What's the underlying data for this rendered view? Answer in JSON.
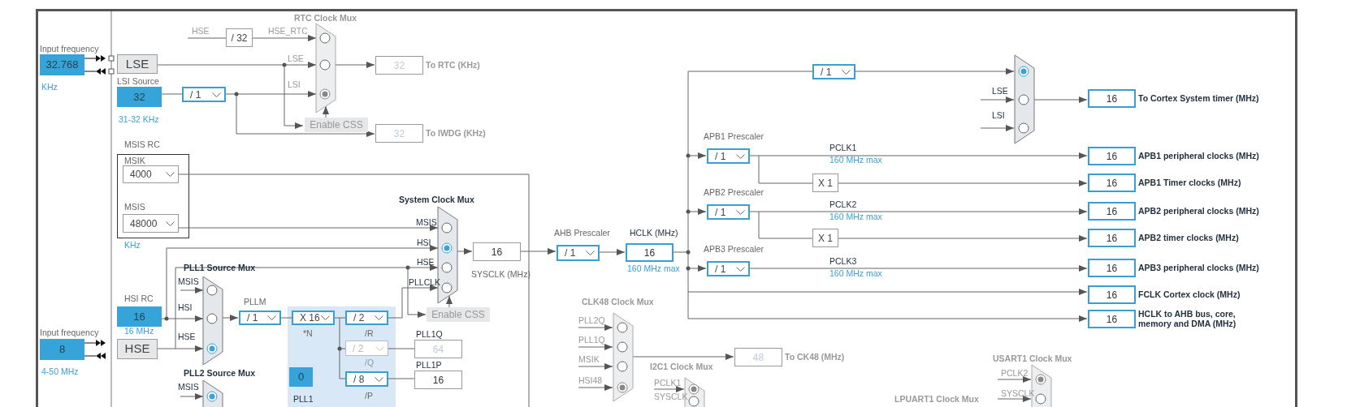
{
  "input_clocks": [
    {
      "label": "Input frequency",
      "value": "32.768",
      "range": "KHz"
    },
    {
      "label": "Input frequency",
      "value": "8",
      "range": "4-50 MHz"
    }
  ],
  "oscillators": [
    {
      "name": "LSE"
    },
    {
      "name": "HSE"
    }
  ],
  "rc_sources": [
    {
      "title": "LSI Source",
      "value": "32",
      "range": "31-32 KHz"
    },
    {
      "title": "HSI RC",
      "value": "16",
      "range": "16 MHz"
    }
  ],
  "msis_rc": {
    "title": "MSIS RC",
    "selectors": [
      {
        "label": "MSIK",
        "value": "4000"
      },
      {
        "label": "MSIS",
        "value": "48000"
      }
    ],
    "unit": "KHz"
  },
  "signal_labels": [
    {
      "text": "HSE"
    }
  ],
  "dividers": [
    {
      "value": "/ 32"
    },
    {
      "value": "X 1"
    },
    {
      "value": "X 1"
    }
  ],
  "prescalers": [
    {
      "value": "/ 1",
      "disabled": false
    },
    {
      "title": "AHB Prescaler",
      "value": "/ 1",
      "disabled": false
    },
    {
      "value": "/ 1",
      "disabled": false
    },
    {
      "title": "APB1 Prescaler",
      "value": "/ 1",
      "disabled": false
    },
    {
      "title": "APB2 Prescaler",
      "value": "/ 1",
      "disabled": false
    },
    {
      "title": "APB3 Prescaler",
      "value": "/ 1",
      "disabled": false
    },
    {
      "title": "PLLM",
      "value": "/ 1",
      "disabled": false
    },
    {
      "value": "X 16",
      "caption": "*N",
      "disabled": false
    },
    {
      "value": "/ 2",
      "caption": "/R",
      "disabled": false
    },
    {
      "value": "/ 2",
      "caption": "/Q",
      "disabled": true
    },
    {
      "value": "/ 8",
      "caption": "/P",
      "disabled": false
    }
  ],
  "muxes": [
    {
      "title": "RTC Clock Mux",
      "active": false,
      "inputs": [
        {
          "label": "HSE_RTC",
          "selected": false
        },
        {
          "label": "LSE",
          "selected": false
        },
        {
          "label": "LSI",
          "selected": true
        }
      ]
    },
    {
      "active": true,
      "inputs": [
        {
          "selected": true
        },
        {
          "label": "LSE",
          "selected": false
        },
        {
          "label": "LSI",
          "selected": false
        }
      ]
    },
    {
      "title": "System Clock Mux",
      "active": true,
      "inputs": [
        {
          "label": "MSIS",
          "selected": false
        },
        {
          "label": "HSI",
          "selected": true
        },
        {
          "label": "HSE",
          "selected": false
        },
        {
          "label": "PLLCLK",
          "selected": false
        }
      ]
    },
    {
      "title": "PLL1 Source Mux",
      "active": true,
      "inputs": [
        {
          "label": "MSIS",
          "selected": false
        },
        {
          "label": "HSI",
          "selected": false
        },
        {
          "label": "HSE",
          "selected": true
        }
      ]
    },
    {
      "title": "PLL2 Source Mux",
      "active": true,
      "inputs": [
        {
          "label": "MSIS",
          "selected": true
        }
      ]
    },
    {
      "title": "CLK48 Clock Mux",
      "active": false,
      "inputs": [
        {
          "label": "PLL2Q",
          "selected": false
        },
        {
          "label": "PLL1Q",
          "selected": false
        },
        {
          "label": "MSIK",
          "selected": false
        },
        {
          "label": "HSI48",
          "selected": true
        }
      ]
    },
    {
      "title": "I2C1 Clock Mux",
      "active": false,
      "inputs": [
        {
          "label": "PCLK1",
          "selected": true
        },
        {
          "label": "SYSCLK",
          "selected": false
        }
      ]
    },
    {
      "title": "USART1 Clock Mux",
      "active": false,
      "inputs": [
        {
          "label": "PCLK2",
          "selected": true
        },
        {
          "label": "SYSCLK",
          "selected": false
        }
      ]
    },
    {
      "title": "LPUART1 Clock Mux",
      "active": false
    }
  ],
  "css_buttons": [
    {
      "label": "Enable CSS",
      "disabled": true
    },
    {
      "label": "Enable CSS",
      "disabled": true
    }
  ],
  "pll1": {
    "label": "PLL1",
    "value": "0"
  },
  "outputs": [
    {
      "value": "32",
      "label": "To RTC (KHz)",
      "kind": "side",
      "highlighted": false,
      "disabled": true
    },
    {
      "value": "32",
      "label": "To IWDG (KHz)",
      "kind": "side",
      "highlighted": false,
      "disabled": true
    },
    {
      "value": "16",
      "label": "SYSCLK (MHz)",
      "kind": "below",
      "highlighted": false,
      "disabled": false
    },
    {
      "value": "16",
      "label": "HCLK (MHz)",
      "kind": "above",
      "caption": "160 MHz max",
      "highlighted": true,
      "disabled": false
    },
    {
      "value": "64",
      "label": "PLL1Q",
      "kind": "above",
      "highlighted": false,
      "disabled": true
    },
    {
      "value": "16",
      "label": "PLL1P",
      "kind": "above",
      "highlighted": false,
      "disabled": false
    },
    {
      "value": "48",
      "label": "To CK48 (MHz)",
      "kind": "side",
      "highlighted": false,
      "disabled": true
    },
    {
      "value": "16",
      "label": "To Cortex System timer (MHz)",
      "kind": "side",
      "highlighted": true,
      "disabled": false
    },
    {
      "value": "16",
      "label": "APB1 peripheral clocks (MHz)",
      "kind": "side",
      "highlighted": true,
      "disabled": false
    },
    {
      "value": "16",
      "label": "APB1 Timer clocks (MHz)",
      "kind": "side",
      "highlighted": true,
      "disabled": false
    },
    {
      "value": "16",
      "label": "APB2 peripheral clocks (MHz)",
      "kind": "side",
      "highlighted": true,
      "disabled": false
    },
    {
      "value": "16",
      "label": "APB2 timer clocks (MHz)",
      "kind": "side",
      "highlighted": true,
      "disabled": false
    },
    {
      "value": "16",
      "label": "APB3 peripheral clocks (MHz)",
      "kind": "side",
      "highlighted": true,
      "disabled": false
    },
    {
      "value": "16",
      "label": "FCLK Cortex clock (MHz)",
      "kind": "side",
      "highlighted": true,
      "disabled": false
    },
    {
      "value": "16",
      "label": "HCLK to AHB bus, core, memory and DMA (MHz)",
      "kind": "side",
      "highlighted": true,
      "disabled": false
    }
  ],
  "bus_labels": [
    {
      "name": "PCLK1",
      "caption": "160 MHz max"
    },
    {
      "name": "PCLK2",
      "caption": "160 MHz max"
    },
    {
      "name": "PCLK3",
      "caption": "160 MHz max"
    }
  ]
}
